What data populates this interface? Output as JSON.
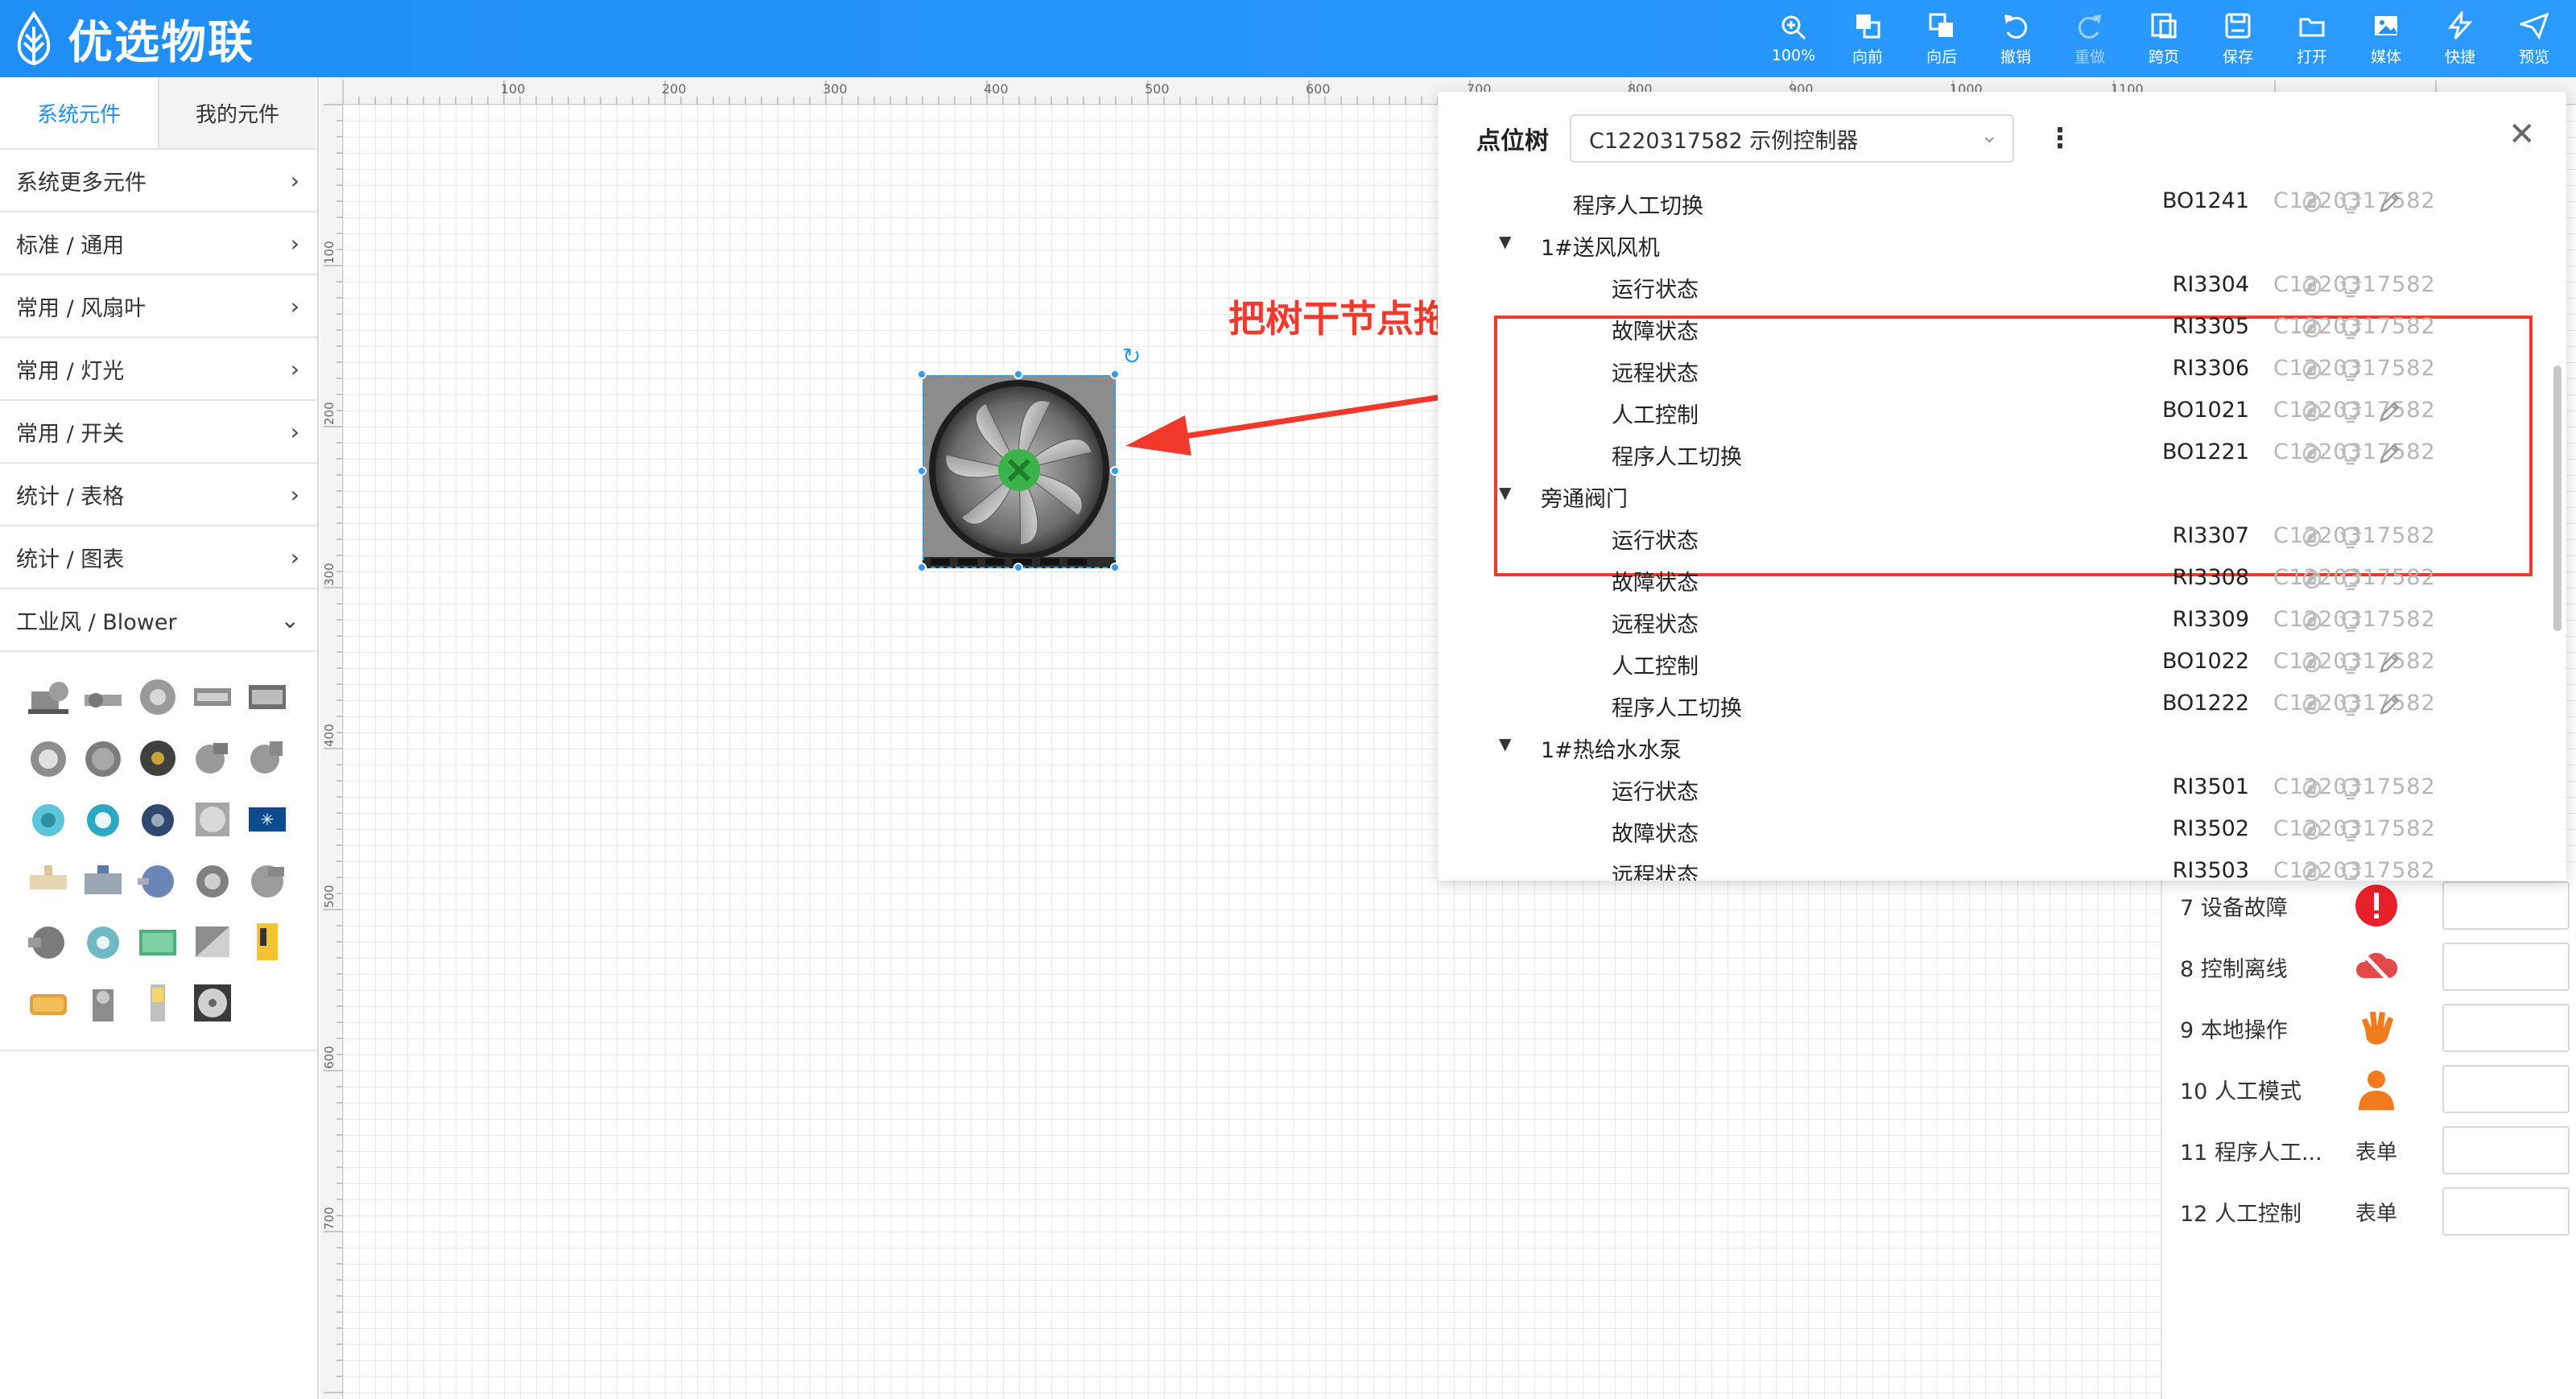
{
  "app": {
    "brand_name": "优选物联",
    "toolbar": [
      {
        "key": "zoom",
        "label": "100%",
        "icon": "zoom-icon",
        "disabled": false
      },
      {
        "key": "forward",
        "label": "向前",
        "icon": "bring-forward-icon",
        "disabled": false
      },
      {
        "key": "backward",
        "label": "向后",
        "icon": "send-backward-icon",
        "disabled": false
      },
      {
        "key": "undo",
        "label": "撤销",
        "icon": "undo-icon",
        "disabled": false
      },
      {
        "key": "redo",
        "label": "重做",
        "icon": "redo-icon",
        "disabled": true
      },
      {
        "key": "cross_page",
        "label": "跨页",
        "icon": "cross-page-icon",
        "disabled": false
      },
      {
        "key": "save",
        "label": "保存",
        "icon": "save-icon",
        "disabled": false
      },
      {
        "key": "open",
        "label": "打开",
        "icon": "folder-open-icon",
        "disabled": false
      },
      {
        "key": "media",
        "label": "媒体",
        "icon": "media-icon",
        "disabled": false
      },
      {
        "key": "shortcut",
        "label": "快捷",
        "icon": "lightning-icon",
        "disabled": false
      },
      {
        "key": "preview",
        "label": "预览",
        "icon": "send-icon",
        "disabled": false
      }
    ]
  },
  "left_panel": {
    "tabs": [
      "系统元件",
      "我的元件"
    ],
    "active_tab": 0,
    "categories": [
      {
        "label": "系统更多元件",
        "expanded": false
      },
      {
        "label": "标准 / 通用",
        "expanded": false
      },
      {
        "label": "常用 / 风扇叶",
        "expanded": false
      },
      {
        "label": "常用 / 灯光",
        "expanded": false
      },
      {
        "label": "常用 / 开关",
        "expanded": false
      },
      {
        "label": "统计 / 表格",
        "expanded": false
      },
      {
        "label": "统计 / 图表",
        "expanded": false
      },
      {
        "label": "工业风 / Blower",
        "expanded": true
      }
    ],
    "palette_count": 29,
    "palette_icon": "blower-component-icon"
  },
  "canvas": {
    "annotation": "把树干节点拖到设备上",
    "ruler_top_labels": [
      "100",
      "200",
      "300",
      "400",
      "500",
      "600",
      "700",
      "800",
      "900",
      "1000",
      "1100"
    ],
    "ruler_left_labels": [
      "100",
      "200",
      "300",
      "400",
      "500",
      "600",
      "700"
    ],
    "selected_device_icon": "exhaust-fan-icon"
  },
  "point_tree": {
    "title": "点位树",
    "controller_select": "C1220317582 示例控制器",
    "rows": [
      {
        "type": "point",
        "name": "程序人工切换",
        "code": "BO1241",
        "controller": "C1220317582",
        "editable": true,
        "deep": false
      },
      {
        "type": "group",
        "name": "1#送风风机"
      },
      {
        "type": "point",
        "name": "运行状态",
        "code": "RI3304",
        "controller": "C1220317582",
        "editable": false,
        "deep": true
      },
      {
        "type": "point",
        "name": "故障状态",
        "code": "RI3305",
        "controller": "C1220317582",
        "editable": false,
        "deep": true
      },
      {
        "type": "point",
        "name": "远程状态",
        "code": "RI3306",
        "controller": "C1220317582",
        "editable": false,
        "deep": true
      },
      {
        "type": "point",
        "name": "人工控制",
        "code": "BO1021",
        "controller": "C1220317582",
        "editable": true,
        "deep": true
      },
      {
        "type": "point",
        "name": "程序人工切换",
        "code": "BO1221",
        "controller": "C1220317582",
        "editable": true,
        "deep": true
      },
      {
        "type": "group",
        "name": "旁通阀门"
      },
      {
        "type": "point",
        "name": "运行状态",
        "code": "RI3307",
        "controller": "C1220317582",
        "editable": false,
        "deep": true
      },
      {
        "type": "point",
        "name": "故障状态",
        "code": "RI3308",
        "controller": "C1220317582",
        "editable": false,
        "deep": true
      },
      {
        "type": "point",
        "name": "远程状态",
        "code": "RI3309",
        "controller": "C1220317582",
        "editable": false,
        "deep": true
      },
      {
        "type": "point",
        "name": "人工控制",
        "code": "BO1022",
        "controller": "C1220317582",
        "editable": true,
        "deep": true
      },
      {
        "type": "point",
        "name": "程序人工切换",
        "code": "BO1222",
        "controller": "C1220317582",
        "editable": true,
        "deep": true
      },
      {
        "type": "group",
        "name": "1#热给水水泵"
      },
      {
        "type": "point",
        "name": "运行状态",
        "code": "RI3501",
        "controller": "C1220317582",
        "editable": false,
        "deep": true
      },
      {
        "type": "point",
        "name": "故障状态",
        "code": "RI3502",
        "controller": "C1220317582",
        "editable": false,
        "deep": true
      },
      {
        "type": "point",
        "name": "远程状态",
        "code": "RI3503",
        "controller": "C1220317582",
        "editable": false,
        "deep": true
      }
    ]
  },
  "state_panel": {
    "rows": [
      {
        "label": "7   设备故障",
        "icon": "alert-circle-icon",
        "icon_text": ""
      },
      {
        "label": "8   控制离线",
        "icon": "cloud-offline-icon",
        "icon_text": ""
      },
      {
        "label": "9   本地操作",
        "icon": "hand-icon",
        "icon_text": ""
      },
      {
        "label": "10 人工模式",
        "icon": "person-icon",
        "icon_text": ""
      },
      {
        "label": "11 程序人工...",
        "icon": "",
        "icon_text": "表单"
      },
      {
        "label": "12 人工控制",
        "icon": "",
        "icon_text": "表单"
      }
    ]
  },
  "colors": {
    "header_blue": "#1f8ef5",
    "accent_blue": "#2d9df0",
    "highlight_red": "#f0382b",
    "alert_red": "#e8202a",
    "warn_orange": "#f07c1d"
  }
}
